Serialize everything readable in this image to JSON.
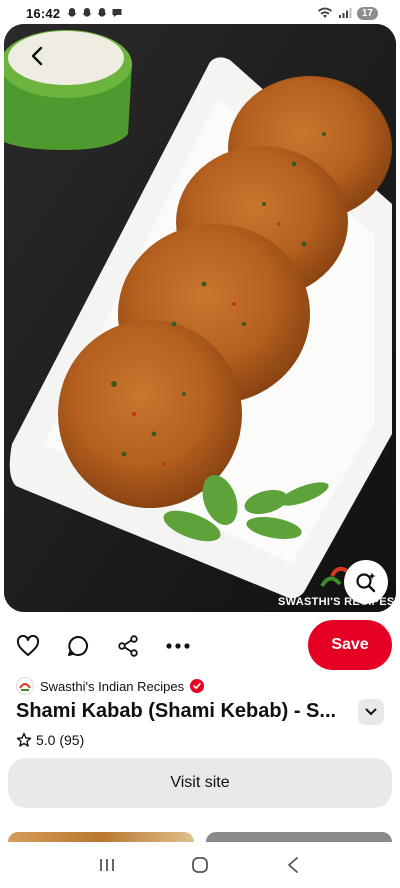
{
  "status_bar": {
    "time": "16:42",
    "battery": "17"
  },
  "hero": {
    "watermark": "SWASTHI'S RECIPES",
    "icons": [
      "back-arrow-icon",
      "visual-search-icon"
    ]
  },
  "actions": {
    "icons": [
      "heart-icon",
      "comment-icon",
      "share-icon",
      "more-icon"
    ],
    "save_label": "Save"
  },
  "creator": {
    "name": "Swasthi's Indian Recipes",
    "verified": true
  },
  "pin": {
    "title": "Shami Kabab (Shami Kebab) - S...",
    "rating": "5.0 (95)"
  },
  "visit_site_label": "Visit site",
  "navigation": {
    "icons": [
      "recent-apps-icon",
      "home-icon",
      "back-icon"
    ]
  },
  "colors": {
    "save": "#e60023",
    "pill": "#e9e9e9"
  }
}
